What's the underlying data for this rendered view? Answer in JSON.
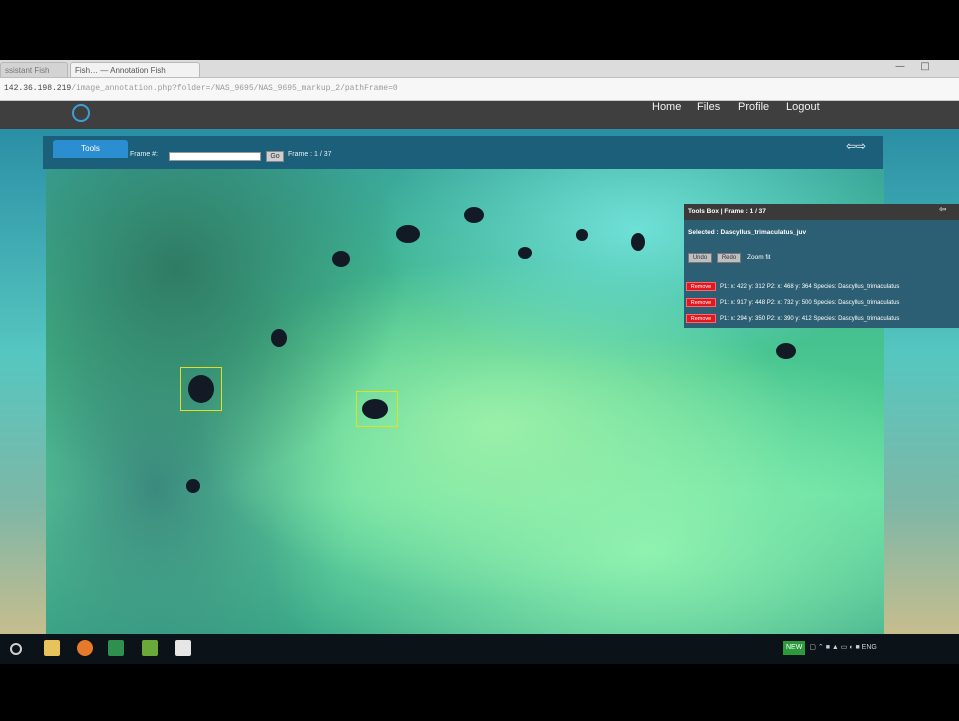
{
  "browser": {
    "tabs": [
      {
        "label": "ssistant Fish"
      },
      {
        "label": "Fish… — Annotation Fish"
      }
    ],
    "url_host": "142.36.198.219",
    "url_path": "/image_annotation.php?folder=/NAS_9695/NAS_9695_markup_2/pathFrame=0",
    "window_controls": {
      "minimize": "—",
      "maximize": "□"
    }
  },
  "navbar": {
    "links": [
      "Home",
      "Files",
      "Profile",
      "Logout"
    ]
  },
  "toolbar": {
    "tools_tab": "Tools",
    "frame_label": "Frame #:",
    "frame_input_value": "",
    "go_label": "Go",
    "frame_count": "Frame : 1 / 37",
    "nav_arrows": "⇦⇨"
  },
  "tools_box": {
    "header": "Tools Box | Frame : 1 / 37",
    "header_arrow": "⇦",
    "selected": "Selected : Dascyllus_trimaculatus_juv",
    "button_1": "Undo",
    "button_2": "Redo",
    "zoom_label": "Zoom fit",
    "remove_label": "Remove",
    "annotations": [
      "P1: x: 422 y: 312 P2: x: 468 y: 364 Species: Dascyllus_trimaculatus",
      "P1: x: 917 y: 448 P2: x: 732 y: 500 Species: Dascyllus_trimaculatus",
      "P1: x: 294 y: 350 P2: x: 390 y: 412 Species: Dascyllus_trimaculatus"
    ]
  },
  "taskbar": {
    "tray_highlight": "NEW",
    "tray_language": "ENG"
  },
  "colors": {
    "navbar": "#3f3f3f",
    "panel_header": "#1b5f7a",
    "tools_tab": "#2b8ed0",
    "remove_button": "#e0181f",
    "bbox": "#e0e020"
  }
}
